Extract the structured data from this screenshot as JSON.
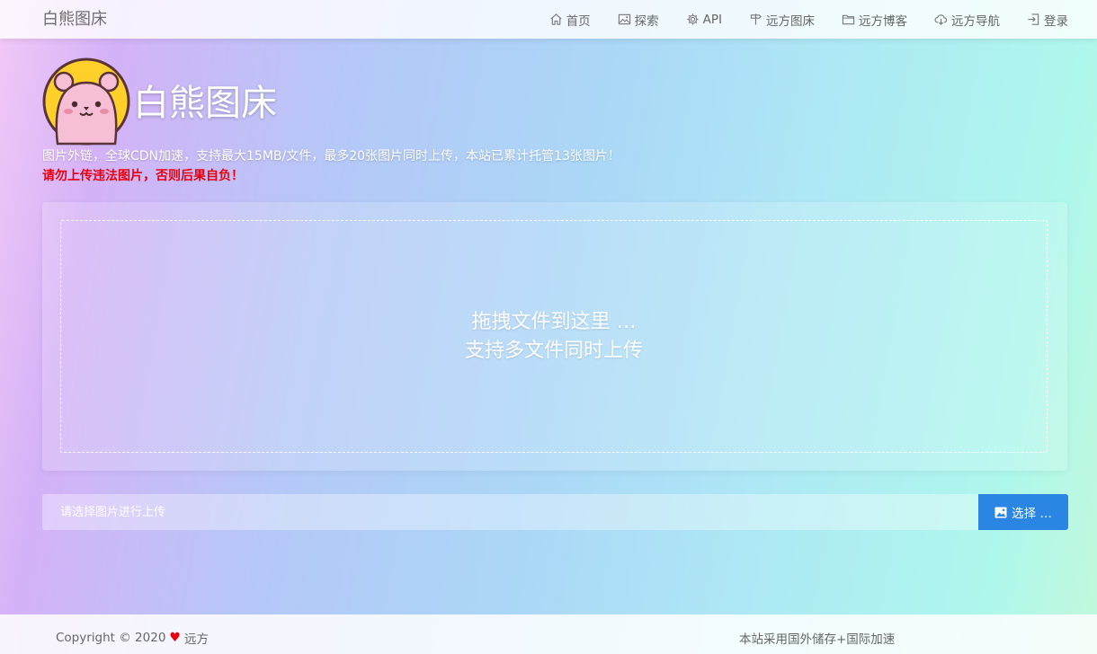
{
  "navbar": {
    "brand": "白熊图床",
    "items": [
      {
        "label": "首页",
        "icon": "home-icon"
      },
      {
        "label": "探索",
        "icon": "image-icon"
      },
      {
        "label": "API",
        "icon": "gear-icon"
      },
      {
        "label": "远方图床",
        "icon": "signpost-icon"
      },
      {
        "label": "远方博客",
        "icon": "folder-icon"
      },
      {
        "label": "远方导航",
        "icon": "cloud-download-icon"
      },
      {
        "label": "登录",
        "icon": "login-icon"
      }
    ]
  },
  "header": {
    "title": "白熊图床",
    "subtitle": "图片外链，全球CDN加速，支持最大15MB/文件，最多20张图片同时上传，本站已累计托管13张图片！",
    "warning": "请勿上传违法图片，否则后果自负！"
  },
  "dropzone": {
    "line1": "拖拽文件到这里 …",
    "line2": "支持多文件同时上传"
  },
  "upload": {
    "placeholder": "请选择图片进行上传",
    "button_label": "选择 …"
  },
  "footer": {
    "copyright_prefix": "Copyright © 2020",
    "author": "远方",
    "note": "本站采用国外储存+国际加速"
  },
  "colors": {
    "accent": "#2b86e3",
    "warning": "#e8000d",
    "logo_ring": "#ffd02a"
  }
}
